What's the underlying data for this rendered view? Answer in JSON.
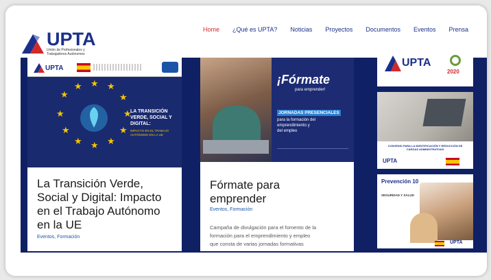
{
  "brand": {
    "name": "UPTA",
    "tagline": "Unión de Profesionales y Trabajadores Autónomos"
  },
  "nav": {
    "items": [
      "Home",
      "¿Qué es UPTA?",
      "Noticias",
      "Proyectos",
      "Documentos",
      "Eventos",
      "Prensa"
    ],
    "active": "Home"
  },
  "colors": {
    "navy": "#102065",
    "brand_blue": "#1b2f8a",
    "brand_red": "#d02a2a",
    "link_blue": "#1b55a8"
  },
  "posts": [
    {
      "image_heading": "LA TRANSICIÓN VERDE, SOCIAL Y DIGITAL:",
      "image_sub": "IMPACTO EN EL TRABAJO AUTÓNOMO EN LA UE",
      "title_lines": [
        "La Transición Verde,",
        "Social y Digital: Impacto",
        "en el Trabajo Autónomo",
        "en la UE"
      ],
      "meta": "Eventos, Formación"
    },
    {
      "image_heading": "¡Fórmate",
      "image_heading_sub": "para emprender!",
      "image_block_title": "JORNADAS PRESENCIALES",
      "image_block_lines": [
        "para la formación del",
        "emprendimiento y",
        "del empleo"
      ],
      "title_lines": [
        "Fórmate para",
        "emprender"
      ],
      "meta": "Eventos, Formación",
      "excerpt": [
        "Campaña de divulgación para el fomento de la",
        "formación para el emprendimiento y empleo",
        "que consta de varias jornadas formativas"
      ]
    }
  ],
  "sidebar": {
    "ad1": {
      "brand": "UPTA",
      "badge": "2020"
    },
    "ad2": {
      "caption": "CONVENIO PARA LA IDENTIFICACIÓN Y REDUCCIÓN DE CARGAS ADMINISTRATIVAS",
      "brand": "UPTA"
    },
    "ad3": {
      "heading": "Prevención 10",
      "sub": "SEGURIDAD Y SALUD",
      "brand": "UPTA"
    }
  }
}
